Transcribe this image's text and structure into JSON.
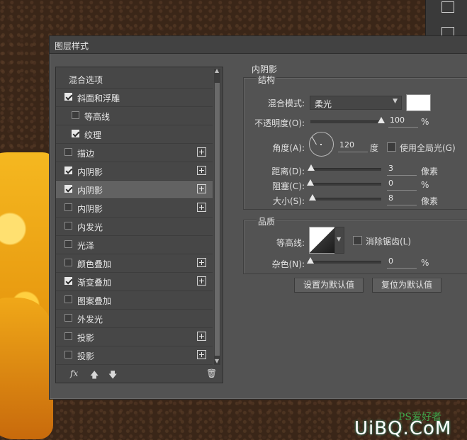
{
  "dialog": {
    "title": "图层样式"
  },
  "styles": [
    {
      "label": "混合选项",
      "checkbox": false,
      "checked": false,
      "plus": false,
      "selected": false,
      "indent": 0
    },
    {
      "label": "斜面和浮雕",
      "checkbox": true,
      "checked": true,
      "plus": false,
      "selected": false,
      "indent": 0
    },
    {
      "label": "等高线",
      "checkbox": true,
      "checked": false,
      "plus": false,
      "selected": false,
      "indent": 1
    },
    {
      "label": "纹理",
      "checkbox": true,
      "checked": true,
      "plus": false,
      "selected": false,
      "indent": 1
    },
    {
      "label": "描边",
      "checkbox": true,
      "checked": false,
      "plus": true,
      "selected": false,
      "indent": 0
    },
    {
      "label": "内阴影",
      "checkbox": true,
      "checked": true,
      "plus": true,
      "selected": false,
      "indent": 0
    },
    {
      "label": "内阴影",
      "checkbox": true,
      "checked": true,
      "plus": true,
      "selected": true,
      "indent": 0
    },
    {
      "label": "内阴影",
      "checkbox": true,
      "checked": false,
      "plus": true,
      "selected": false,
      "indent": 0
    },
    {
      "label": "内发光",
      "checkbox": true,
      "checked": false,
      "plus": false,
      "selected": false,
      "indent": 0
    },
    {
      "label": "光泽",
      "checkbox": true,
      "checked": false,
      "plus": false,
      "selected": false,
      "indent": 0
    },
    {
      "label": "颜色叠加",
      "checkbox": true,
      "checked": false,
      "plus": true,
      "selected": false,
      "indent": 0
    },
    {
      "label": "渐变叠加",
      "checkbox": true,
      "checked": true,
      "plus": true,
      "selected": false,
      "indent": 0
    },
    {
      "label": "图案叠加",
      "checkbox": true,
      "checked": false,
      "plus": false,
      "selected": false,
      "indent": 0
    },
    {
      "label": "外发光",
      "checkbox": true,
      "checked": false,
      "plus": false,
      "selected": false,
      "indent": 0
    },
    {
      "label": "投影",
      "checkbox": true,
      "checked": false,
      "plus": true,
      "selected": false,
      "indent": 0
    },
    {
      "label": "投影",
      "checkbox": true,
      "checked": false,
      "plus": true,
      "selected": false,
      "indent": 0
    }
  ],
  "footer": {
    "fx_label": "fx",
    "up_glyph": "🡅",
    "down_glyph": "🡇",
    "trash_glyph": "🗑"
  },
  "panel": {
    "heading": "内阴影",
    "structure": {
      "title": "结构",
      "blend_mode_label": "混合模式:",
      "blend_mode_value": "柔光",
      "blend_color": "#ffffff",
      "opacity_label": "不透明度(O):",
      "opacity_value": "100",
      "opacity_unit": "%",
      "angle_label": "角度(A):",
      "angle_value": "120",
      "angle_unit": "度",
      "global_light_label": "使用全局光(G)",
      "global_light_checked": false,
      "distance_label": "距离(D):",
      "distance_value": "3",
      "distance_unit": "像素",
      "choke_label": "阻塞(C):",
      "choke_value": "0",
      "choke_unit": "%",
      "size_label": "大小(S):",
      "size_value": "8",
      "size_unit": "像素"
    },
    "quality": {
      "title": "品质",
      "contour_label": "等高线:",
      "antialias_label": "消除锯齿(L)",
      "antialias_checked": false,
      "noise_label": "杂色(N):",
      "noise_value": "0",
      "noise_unit": "%"
    },
    "buttons": {
      "make_default": "设置为默认值",
      "reset_default": "复位为默认值"
    }
  },
  "watermark": {
    "line1": "PS爱好者",
    "line2": "UiBQ.CoM"
  }
}
